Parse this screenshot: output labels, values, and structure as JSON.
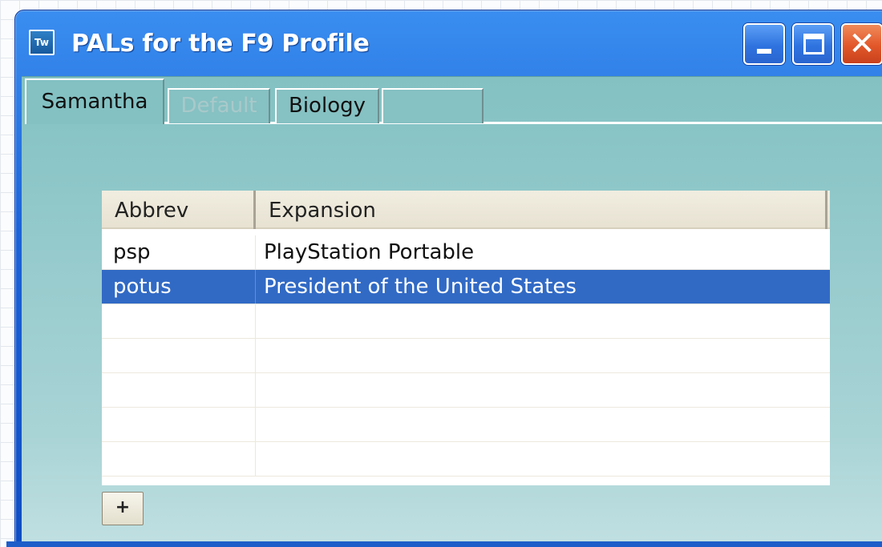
{
  "window": {
    "app_icon_text": "Tw",
    "title": "PALs for the F9 Profile",
    "controls": {
      "minimize": "minimize",
      "maximize": "maximize",
      "close": "✕"
    }
  },
  "tabs": [
    {
      "label": "Samantha",
      "active": true,
      "enabled": true
    },
    {
      "label": "Default",
      "active": false,
      "enabled": false
    },
    {
      "label": "Biology",
      "active": false,
      "enabled": true
    },
    {
      "label": "",
      "active": false,
      "enabled": true
    }
  ],
  "table": {
    "columns": [
      "Abbrev",
      "Expansion"
    ],
    "rows": [
      {
        "abbrev": "psp",
        "expansion": "PlayStation Portable",
        "selected": false
      },
      {
        "abbrev": "potus",
        "expansion": "President of the United States",
        "selected": true
      },
      {
        "abbrev": "",
        "expansion": "",
        "selected": false
      },
      {
        "abbrev": "",
        "expansion": "",
        "selected": false
      },
      {
        "abbrev": "",
        "expansion": "",
        "selected": false
      },
      {
        "abbrev": "",
        "expansion": "",
        "selected": false
      },
      {
        "abbrev": "",
        "expansion": "",
        "selected": false
      }
    ]
  },
  "add_button_label": "+",
  "colors": {
    "titlebar": "#1d63d8",
    "client_bg": "#83c1c3",
    "selection": "#316ac5",
    "close_button": "#e2572a"
  }
}
